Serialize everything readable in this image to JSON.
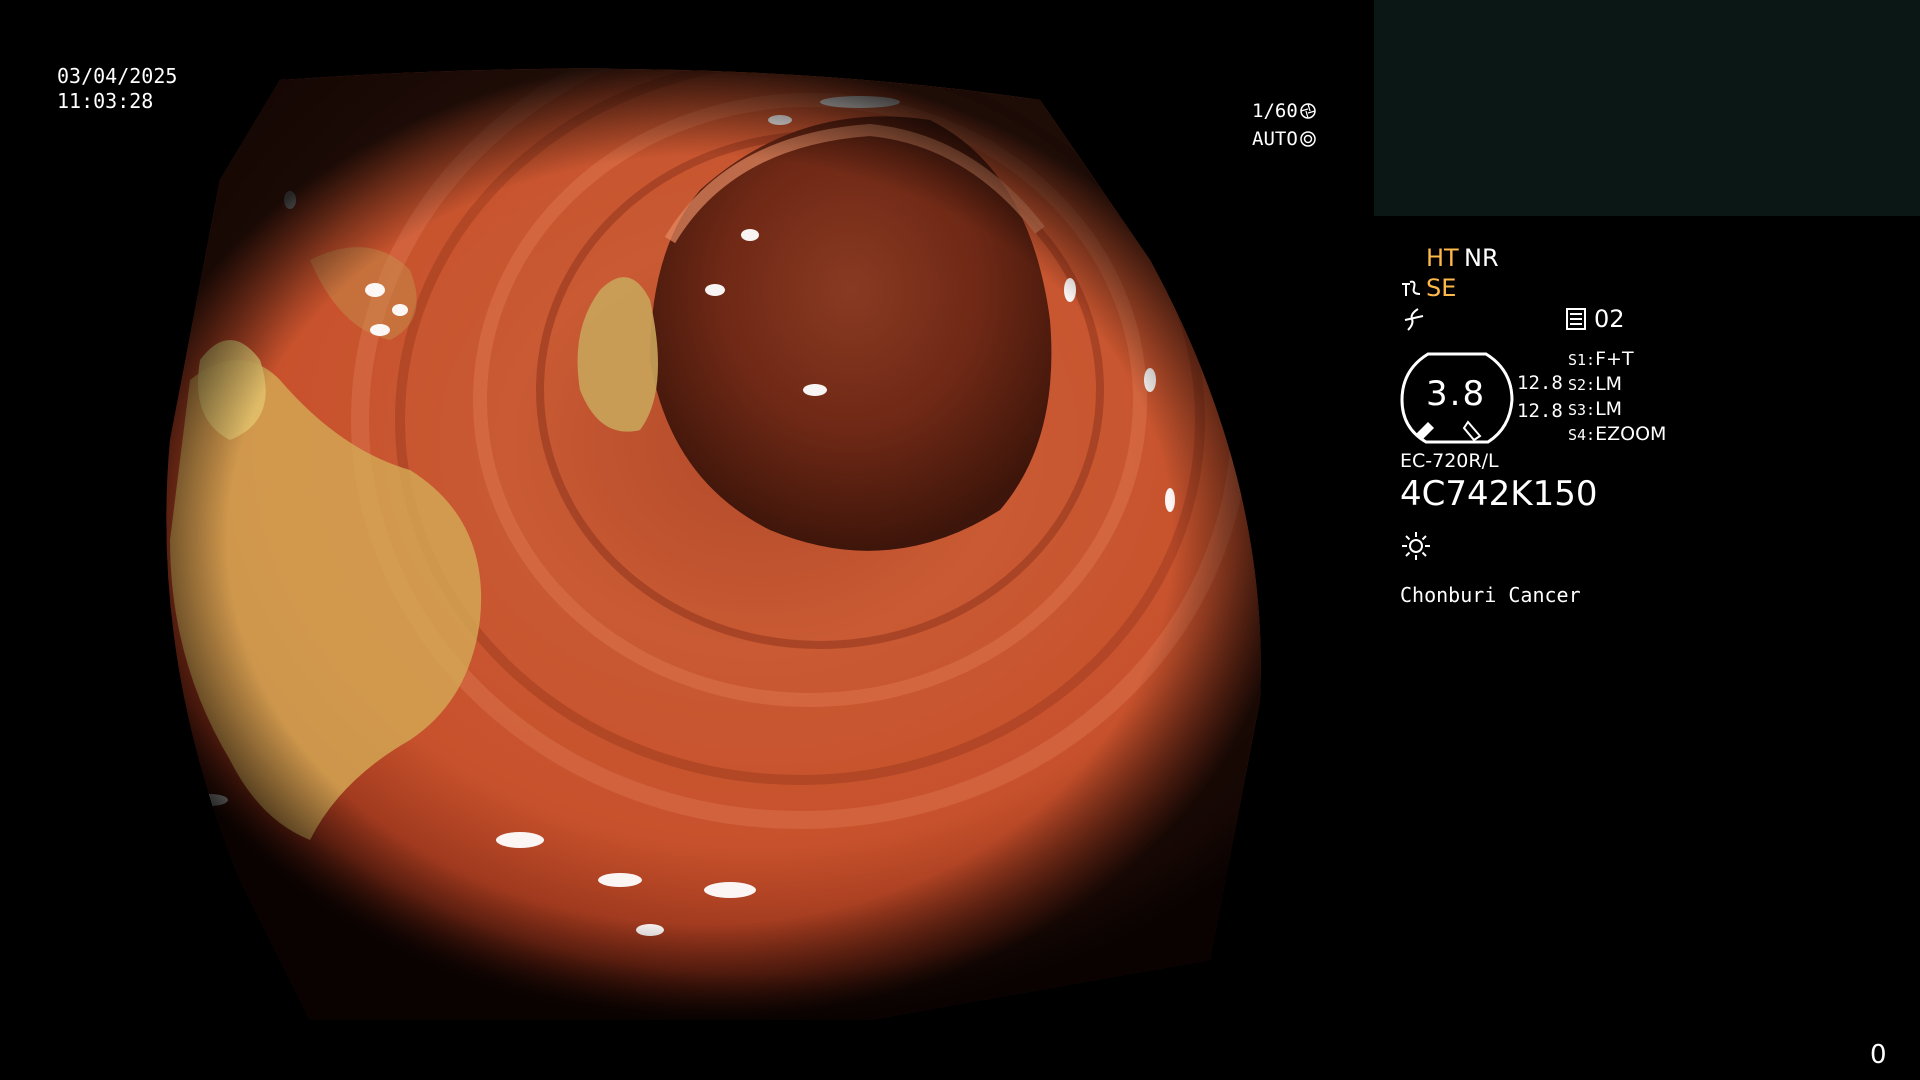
{
  "overlay": {
    "date": "03/04/2025",
    "time": "11:03:28",
    "shutter": "1/60",
    "iris": "AUTO",
    "counter": "0"
  },
  "panel": {
    "ht": "HT",
    "nr": "NR",
    "se": "SE",
    "record_number": "02",
    "gauge_value": "3.8",
    "value_a": "12.8",
    "value_b": "12.8",
    "settings": [
      {
        "label": "S1:",
        "value": "F+T"
      },
      {
        "label": "S2:",
        "value": "LM"
      },
      {
        "label": "S3:",
        "value": "LM"
      },
      {
        "label": "S4:",
        "value": "EZOOM"
      }
    ],
    "model": "EC-720R/L",
    "serial": "4C742K150",
    "hospital": "Chonburi Cancer"
  },
  "icons": {
    "shutter": "shutter-icon",
    "iris": "iris-icon",
    "se": "enhancement-icon",
    "freeze": "freeze-icon",
    "record": "record-icon",
    "light": "light-icon"
  },
  "colors": {
    "accent": "#ffb84a",
    "mucosa": "#c8552f",
    "lumen": "#5a1d10",
    "residue": "#d9b25a",
    "thumb_panel": "#0b1714"
  }
}
